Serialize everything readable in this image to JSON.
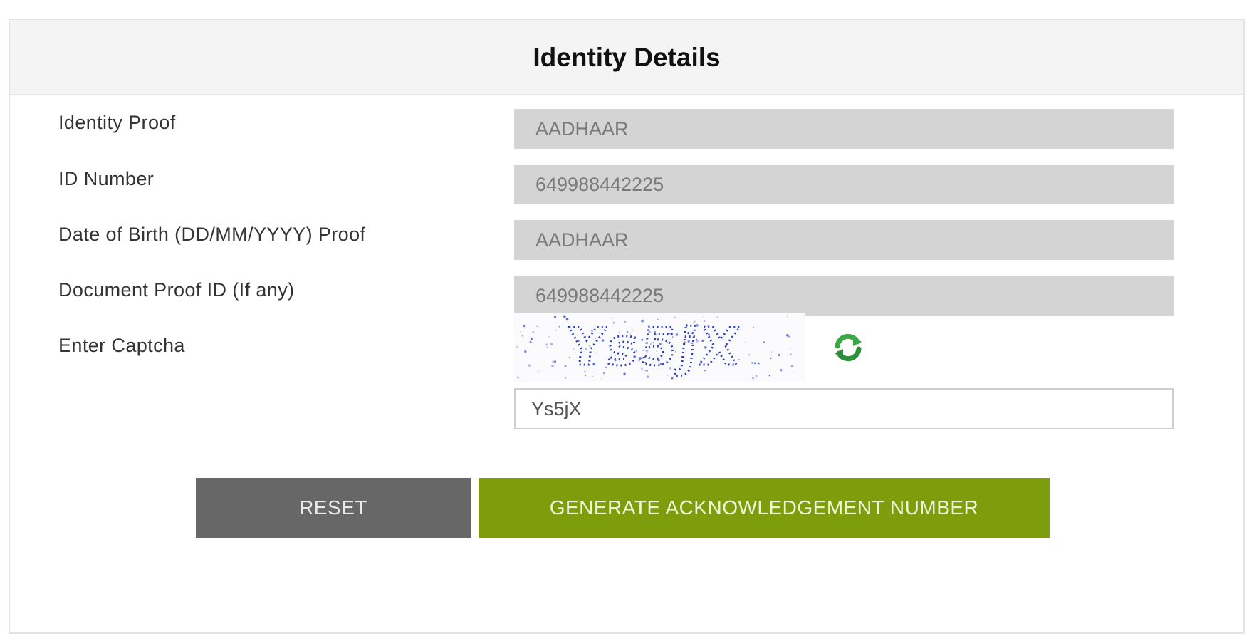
{
  "header": {
    "title": "Identity Details"
  },
  "fields": [
    {
      "label": "Identity Proof",
      "value": "AADHAAR"
    },
    {
      "label": "ID Number",
      "value": "649988442225"
    },
    {
      "label": "Date of Birth (DD/MM/YYYY) Proof",
      "value": "AADHAAR"
    },
    {
      "label": "Document Proof ID (If any)",
      "value": "649988442225"
    }
  ],
  "captcha": {
    "label": "Enter Captcha",
    "image_text": "Ys5jX",
    "input_value": "Ys5jX",
    "refresh_icon": "refresh-icon"
  },
  "buttons": {
    "reset_label": "RESET",
    "generate_label": "GENERATE ACKNOWLEDGEMENT NUMBER"
  },
  "colors": {
    "reset_bg": "#676767",
    "generate_bg": "#7d9d0c",
    "readonly_bg": "#d4d4d4",
    "captcha_text": "#2a3fb8",
    "refresh_icon": "#3aa845"
  }
}
